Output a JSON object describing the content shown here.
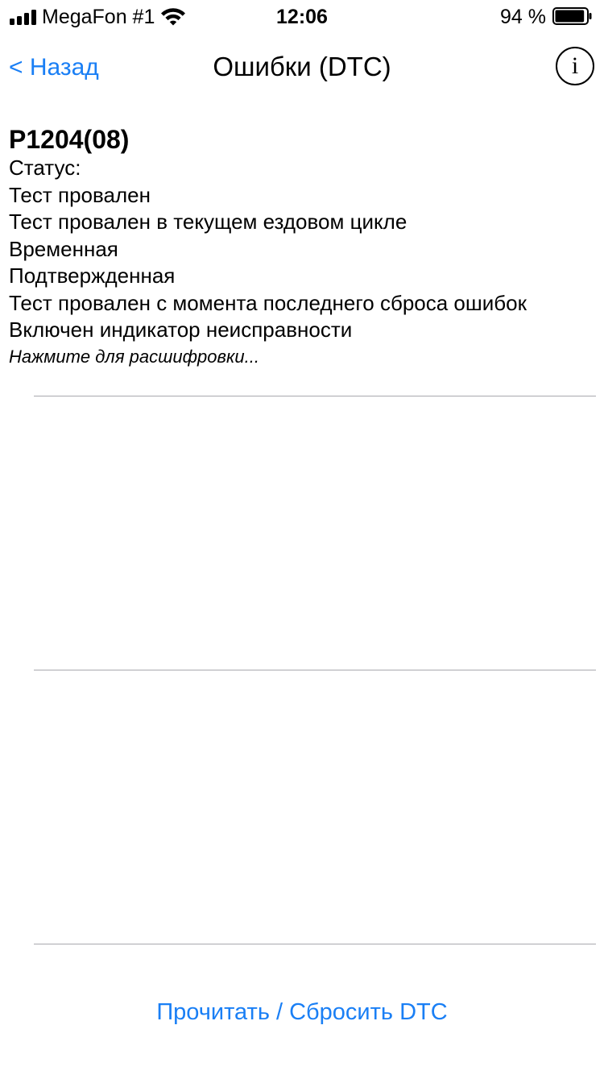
{
  "status_bar": {
    "carrier": "MegaFon #1",
    "time": "12:06",
    "battery_text": "94 %",
    "battery_level": 0.94,
    "icons": [
      "signal-icon",
      "wifi-icon",
      "battery-icon"
    ]
  },
  "nav": {
    "back_label": "< Назад",
    "title": "Ошибки (DTC)",
    "info_label": "i"
  },
  "dtc": {
    "code": "P1204(08)",
    "status_label": "Статус:",
    "status_lines": [
      "Тест провален",
      "Тест провален в текущем ездовом цикле",
      "Временная",
      "Подтвержденная",
      "Тест провален с момента последнего сброса ошибок",
      "Включен индикатор неисправности"
    ],
    "hint": "Нажмите для расшифровки..."
  },
  "footer": {
    "button_label": "Прочитать / Сбросить DTC"
  },
  "colors": {
    "accent": "#1a7ff5",
    "separator": "#a8a8ad",
    "text": "#000000",
    "background": "#ffffff"
  }
}
